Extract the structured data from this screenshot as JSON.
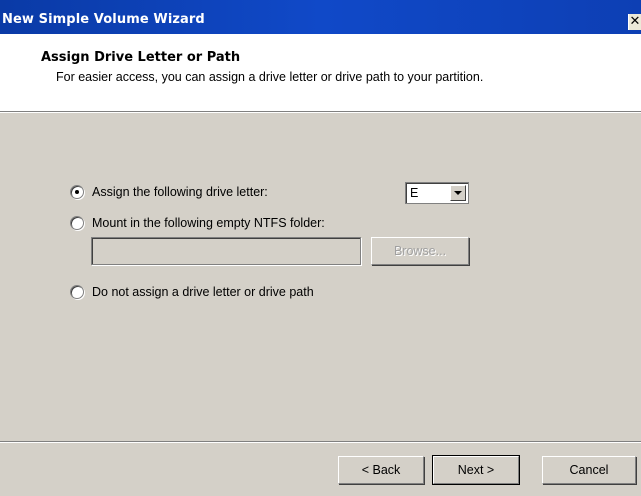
{
  "window": {
    "title": "New Simple Volume Wizard",
    "close_glyph": "✕"
  },
  "header": {
    "title": "Assign Drive Letter or Path",
    "subtitle": "For easier access, you can assign a drive letter or drive path to your partition."
  },
  "options": {
    "assign_letter": {
      "label": "Assign the following drive letter:",
      "selected": true
    },
    "mount_folder": {
      "label": "Mount in the following empty NTFS folder:",
      "selected": false
    },
    "no_assign": {
      "label": "Do not assign a drive letter or drive path",
      "selected": false
    }
  },
  "drive_letter": {
    "value": "E"
  },
  "folder_path": {
    "value": "",
    "enabled": false
  },
  "browse": {
    "label": "Browse...",
    "enabled": false
  },
  "footer": {
    "back_label": "< Back",
    "next_label": "Next >",
    "cancel_label": "Cancel"
  },
  "colors": {
    "titlebar": "#0b3cb8",
    "dialog_bg": "#d4d0c8",
    "header_bg": "#ffffff"
  }
}
